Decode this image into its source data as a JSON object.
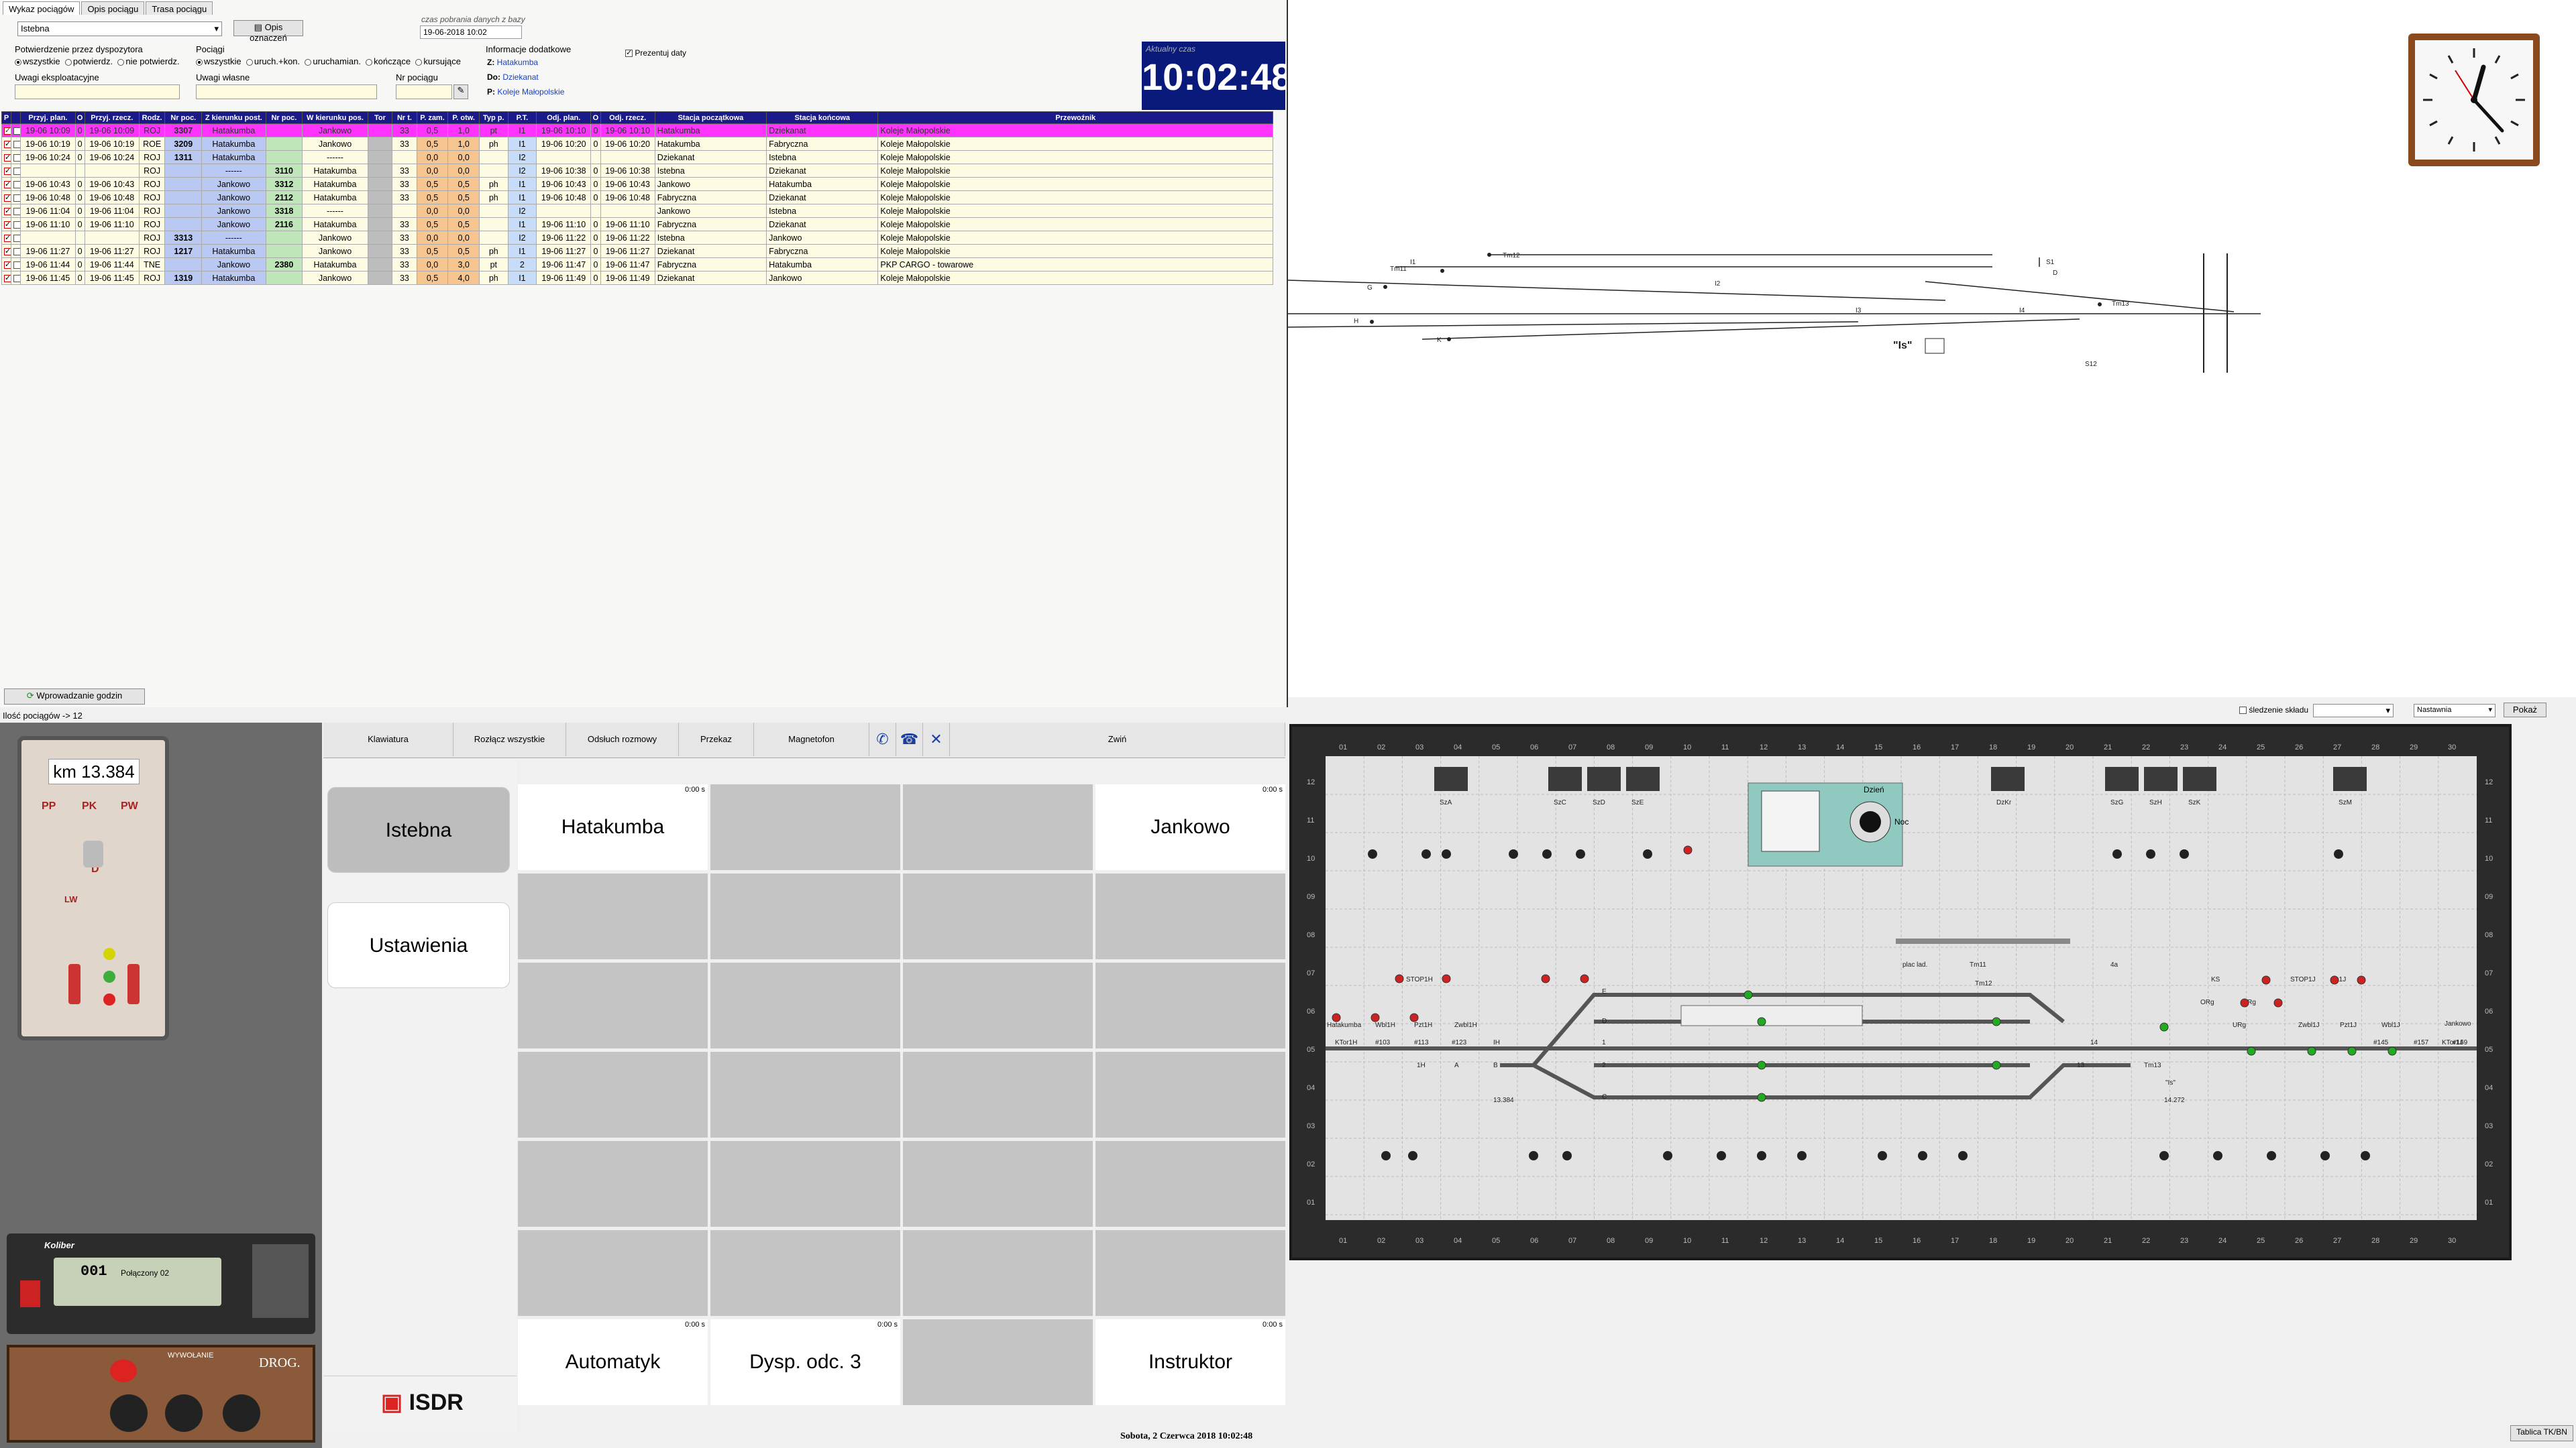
{
  "tabs": [
    "Wykaz pociągów",
    "Opis pociągu",
    "Trasa pociągu"
  ],
  "station_select": "Istebna",
  "legend_button": "Opis oznaczeń",
  "load_time": {
    "label": "czas pobrania danych z bazy",
    "value": "19-06-2018 10:02"
  },
  "confirm_group": {
    "label": "Potwierdzenie przez dyspozytora",
    "options": [
      "wszystkie",
      "potwierdz.",
      "nie potwierdz."
    ]
  },
  "trains_group": {
    "label": "Pociągi",
    "options": [
      "wszystkie",
      "uruch.+kon.",
      "uruchamian.",
      "kończące",
      "kursujące"
    ]
  },
  "extra_info": {
    "label": "Informacje dodatkowe",
    "z_label": "Z:",
    "z": "Hatakumba",
    "do_label": "Do:",
    "do": "Dziekanat",
    "p_label": "P:",
    "p": "Koleje Małopolskie"
  },
  "show_dates": "Prezentuj daty",
  "actual_time": {
    "label": "Aktualny czas",
    "value": "10:02:48"
  },
  "remarks": {
    "exploitation": "Uwagi eksploatacyjne",
    "own": "Uwagi własne",
    "train_no": "Nr pociągu"
  },
  "columns": [
    "P",
    "",
    "Przyj. plan.",
    "O",
    "Przyj. rzecz.",
    "Rodz.",
    "Nr poc.",
    "Z kierunku post.",
    "Nr poc.",
    "W kierunku pos.",
    "Tor",
    "Nr t.",
    "P. zam.",
    "P. otw.",
    "Typ p.",
    "P.T.",
    "Odj. plan.",
    "O",
    "Odj. rzecz.",
    "Stacja początkowa",
    "Stacja końcowa",
    "Przewoźnik"
  ],
  "rows": [
    {
      "hl": true,
      "c1": true,
      "c2": false,
      "a1": "19-06 10:09",
      "o1": "0",
      "a2": "19-06 10:09",
      "k": "ROJ",
      "n1": "3307",
      "z": "Hatakumba",
      "n2": "",
      "w": "Jankowo",
      "tor": "",
      "nt": "33",
      "pz": "0,5",
      "po": "1,0",
      "typ": "pt",
      "pt": "I1",
      "d1": "19-06 10:10",
      "o2": "0",
      "d2": "19-06 10:10",
      "sp": "Hatakumba",
      "sk": "Dziekanat",
      "pr": "Koleje Małopolskie"
    },
    {
      "hl": false,
      "c1": true,
      "c2": false,
      "a1": "19-06 10:19",
      "o1": "0",
      "a2": "19-06 10:19",
      "k": "ROE",
      "n1": "3209",
      "z": "Hatakumba",
      "n2": "",
      "w": "Jankowo",
      "tor": "",
      "nt": "33",
      "pz": "0,5",
      "po": "1,0",
      "typ": "ph",
      "pt": "I1",
      "d1": "19-06 10:20",
      "o2": "0",
      "d2": "19-06 10:20",
      "sp": "Hatakumba",
      "sk": "Fabryczna",
      "pr": "Koleje Małopolskie"
    },
    {
      "hl": false,
      "c1": true,
      "c2": false,
      "a1": "19-06 10:24",
      "o1": "0",
      "a2": "19-06 10:24",
      "k": "ROJ",
      "n1": "1311",
      "z": "Hatakumba",
      "n2": "",
      "w": "------",
      "tor": "",
      "nt": "",
      "pz": "0,0",
      "po": "0,0",
      "typ": "",
      "pt": "I2",
      "d1": "",
      "o2": "",
      "d2": "",
      "sp": "Dziekanat",
      "sk": "Istebna",
      "pr": "Koleje Małopolskie"
    },
    {
      "hl": false,
      "c1": true,
      "c2": false,
      "a1": "",
      "o1": "",
      "a2": "",
      "k": "ROJ",
      "n1": "",
      "z": "------",
      "n2": "3110",
      "w": "Hatakumba",
      "tor": "",
      "nt": "33",
      "pz": "0,0",
      "po": "0,0",
      "typ": "",
      "pt": "I2",
      "d1": "19-06 10:38",
      "o2": "0",
      "d2": "19-06 10:38",
      "sp": "Istebna",
      "sk": "Dziekanat",
      "pr": "Koleje Małopolskie"
    },
    {
      "hl": false,
      "c1": true,
      "c2": false,
      "a1": "19-06 10:43",
      "o1": "0",
      "a2": "19-06 10:43",
      "k": "ROJ",
      "n1": "",
      "z": "Jankowo",
      "n2": "3312",
      "w": "Hatakumba",
      "tor": "",
      "nt": "33",
      "pz": "0,5",
      "po": "0,5",
      "typ": "ph",
      "pt": "I1",
      "d1": "19-06 10:43",
      "o2": "0",
      "d2": "19-06 10:43",
      "sp": "Jankowo",
      "sk": "Hatakumba",
      "pr": "Koleje Małopolskie"
    },
    {
      "hl": false,
      "c1": true,
      "c2": false,
      "a1": "19-06 10:48",
      "o1": "0",
      "a2": "19-06 10:48",
      "k": "ROJ",
      "n1": "",
      "z": "Jankowo",
      "n2": "2112",
      "w": "Hatakumba",
      "tor": "",
      "nt": "33",
      "pz": "0,5",
      "po": "0,5",
      "typ": "ph",
      "pt": "I1",
      "d1": "19-06 10:48",
      "o2": "0",
      "d2": "19-06 10:48",
      "sp": "Fabryczna",
      "sk": "Dziekanat",
      "pr": "Koleje Małopolskie"
    },
    {
      "hl": false,
      "c1": true,
      "c2": false,
      "a1": "19-06 11:04",
      "o1": "0",
      "a2": "19-06 11:04",
      "k": "ROJ",
      "n1": "",
      "z": "Jankowo",
      "n2": "3318",
      "w": "------",
      "tor": "",
      "nt": "",
      "pz": "0,0",
      "po": "0,0",
      "typ": "",
      "pt": "I2",
      "d1": "",
      "o2": "",
      "d2": "",
      "sp": "Jankowo",
      "sk": "Istebna",
      "pr": "Koleje Małopolskie"
    },
    {
      "hl": false,
      "c1": true,
      "c2": false,
      "a1": "19-06 11:10",
      "o1": "0",
      "a2": "19-06 11:10",
      "k": "ROJ",
      "n1": "",
      "z": "Jankowo",
      "n2": "2116",
      "w": "Hatakumba",
      "tor": "",
      "nt": "33",
      "pz": "0,5",
      "po": "0,5",
      "typ": "",
      "pt": "I1",
      "d1": "19-06 11:10",
      "o2": "0",
      "d2": "19-06 11:10",
      "sp": "Fabryczna",
      "sk": "Dziekanat",
      "pr": "Koleje Małopolskie"
    },
    {
      "hl": false,
      "c1": true,
      "c2": false,
      "a1": "",
      "o1": "",
      "a2": "",
      "k": "ROJ",
      "n1": "3313",
      "z": "------",
      "n2": "",
      "w": "Jankowo",
      "tor": "",
      "nt": "33",
      "pz": "0,0",
      "po": "0,0",
      "typ": "",
      "pt": "I2",
      "d1": "19-06 11:22",
      "o2": "0",
      "d2": "19-06 11:22",
      "sp": "Istebna",
      "sk": "Jankowo",
      "pr": "Koleje Małopolskie"
    },
    {
      "hl": false,
      "c1": true,
      "c2": false,
      "a1": "19-06 11:27",
      "o1": "0",
      "a2": "19-06 11:27",
      "k": "ROJ",
      "n1": "1217",
      "z": "Hatakumba",
      "n2": "",
      "w": "Jankowo",
      "tor": "",
      "nt": "33",
      "pz": "0,5",
      "po": "0,5",
      "typ": "ph",
      "pt": "I1",
      "d1": "19-06 11:27",
      "o2": "0",
      "d2": "19-06 11:27",
      "sp": "Dziekanat",
      "sk": "Fabryczna",
      "pr": "Koleje Małopolskie"
    },
    {
      "hl": false,
      "c1": true,
      "c2": false,
      "a1": "19-06 11:44",
      "o1": "0",
      "a2": "19-06 11:44",
      "k": "TNE",
      "n1": "",
      "z": "Jankowo",
      "n2": "2380",
      "w": "Hatakumba",
      "tor": "",
      "nt": "33",
      "pz": "0,0",
      "po": "3,0",
      "typ": "pt",
      "pt": "2",
      "d1": "19-06 11:47",
      "o2": "0",
      "d2": "19-06 11:47",
      "sp": "Fabryczna",
      "sk": "Hatakumba",
      "pr": "PKP CARGO - towarowe"
    },
    {
      "hl": false,
      "c1": true,
      "c2": false,
      "a1": "19-06 11:45",
      "o1": "0",
      "a2": "19-06 11:45",
      "k": "ROJ",
      "n1": "1319",
      "z": "Hatakumba",
      "n2": "",
      "w": "Jankowo",
      "tor": "",
      "nt": "33",
      "pz": "0,5",
      "po": "4,0",
      "typ": "ph",
      "pt": "I1",
      "d1": "19-06 11:49",
      "o2": "0",
      "d2": "19-06 11:49",
      "sp": "Dziekanat",
      "sk": "Jankowo",
      "pr": "Koleje Małopolskie"
    }
  ],
  "hours_button": "Wprowadzanie godzin",
  "status": "Ilość pociągów -> 12",
  "track": {
    "labels": [
      "Tm11",
      "Tm12",
      "G",
      "H",
      "K",
      "I1",
      "I2",
      "I3",
      "I4",
      "S1",
      "D",
      "Tm13",
      "S12",
      "\"Is\""
    ]
  },
  "bottom_bar": {
    "composition": "śledzenie składu",
    "settings": "Nastawnia",
    "show": "Pokaż"
  },
  "panel_board": {
    "columns": [
      "01",
      "02",
      "03",
      "04",
      "05",
      "06",
      "07",
      "08",
      "09",
      "10",
      "11",
      "12",
      "13",
      "14",
      "15",
      "16",
      "17",
      "18",
      "19",
      "20",
      "21",
      "22",
      "23",
      "24",
      "25",
      "26",
      "27",
      "28",
      "29",
      "30"
    ],
    "rows": [
      "12",
      "11",
      "10",
      "09",
      "08",
      "07",
      "06",
      "05",
      "04",
      "03",
      "02",
      "01"
    ],
    "top_labels": [
      "SzA",
      "SzC",
      "SzD",
      "SzE",
      "DzKr",
      "SzG",
      "SzH",
      "SzK",
      "SzM"
    ],
    "signals": [
      "KTor1H",
      "#103",
      "#113",
      "#123",
      "IH",
      "1H",
      "A",
      "B",
      "1",
      "2",
      "C",
      "D",
      "E",
      "Tm11",
      "Tm12",
      "Tm13",
      "14",
      "13",
      "4a",
      "KS",
      "ORg",
      "ZRg",
      "URg",
      "STOP1J",
      "A1J",
      "Wbl1J",
      "Pzt1J",
      "Zwbl1J",
      "KTor1J",
      "#145",
      "#157",
      "#169",
      "Jankowo",
      "Hatakumba",
      "Wbl1H",
      "Pzt1H",
      "Zwbl1H",
      "STOP1H",
      "plac lad.",
      "13.384",
      "14.272",
      "\"Is\""
    ],
    "day": "Dzień",
    "night": "Noc"
  },
  "table_button": "Tablica TK/BN",
  "device": {
    "km": "km 13.384",
    "pp": "PP",
    "pk": "PK",
    "pw": "PW",
    "d": "D",
    "lw": "LW",
    "radio_brand": "Koliber",
    "radio_display": "Połączony 02",
    "radio_channel": "001",
    "panel_label": "DROG.",
    "wywolanie": "WYWOŁANIE"
  },
  "menu": [
    "Klawiatura",
    "Rozłącz wszystkie",
    "Odsłuch rozmowy",
    "Przekaz",
    "Magnetofon",
    "",
    "",
    "",
    "Zwiń"
  ],
  "stations": {
    "current": "Istebna",
    "settings": "Ustawienia"
  },
  "grid": [
    {
      "label": "Hatakumba",
      "time": "0:00 s",
      "white": true
    },
    {
      "label": "",
      "time": "",
      "white": false
    },
    {
      "label": "",
      "time": "",
      "white": false
    },
    {
      "label": "Jankowo",
      "time": "0:00 s",
      "white": true
    },
    {
      "label": "Automatyk",
      "time": "0:00 s",
      "white": true
    },
    {
      "label": "Dysp. odc. 3",
      "time": "0:00 s",
      "white": true
    },
    {
      "label": "",
      "time": "",
      "white": false
    },
    {
      "label": "Instruktor",
      "time": "0:00 s",
      "white": true
    }
  ],
  "logo": "ISDR",
  "date_line": "Sobota, 2 Czerwca 2018     10:02:48",
  "colors": {
    "header": "#1a1a8a",
    "highlight": "#ff33ff",
    "clock_bg": "#0a1a7a",
    "board": "#e3e3e3"
  }
}
